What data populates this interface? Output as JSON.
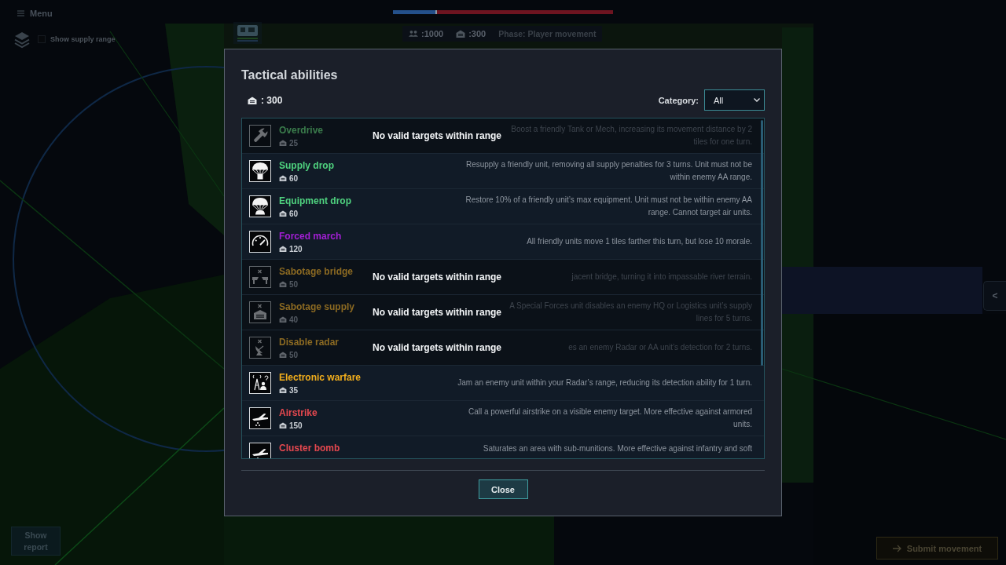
{
  "hud": {
    "menu_button": "Menu",
    "balance_bar": {
      "level": 0.2
    },
    "supply_range_toggle": {
      "label": "Show supply range",
      "checked": false
    },
    "resources": [
      ":1000",
      ":300"
    ],
    "phase": "Phase: Player movement",
    "side_panel_toggle": "<",
    "show_report_button": "Show report",
    "submit_button": "Submit movement"
  },
  "dialog": {
    "title": "Tactical abilities",
    "budget": ": 300",
    "category": {
      "label": "Category:",
      "value": "All"
    },
    "abilities": [
      {
        "name": "Overdrive",
        "color": "#3b7d4c",
        "cost": "25",
        "description": "Boost a friendly Tank or Mech, increasing its movement distance by 2 tiles for one turn.",
        "disabled": true,
        "notice": "No valid targets within range"
      },
      {
        "name": "Supply drop",
        "color": "#4fd27f",
        "cost": "60",
        "description": "Resupply a friendly unit, removing all supply penalties for 3 turns. Unit must not be within enemy AA range.",
        "disabled": false
      },
      {
        "name": "Equipment drop",
        "color": "#4fd27f",
        "cost": "60",
        "description": "Restore 10% of a friendly unit’s max equipment. Unit must not be within enemy AA range. Cannot target air units.",
        "disabled": false
      },
      {
        "name": "Forced march",
        "color": "#a41fd6",
        "cost": "120",
        "description": "All friendly units move 1 tiles farther this turn, but lose 10 morale.",
        "disabled": false
      },
      {
        "name": "Sabotage bridge",
        "color": "#8c6a22",
        "cost": "50",
        "description": "jacent bridge, turning it into impassable river terrain.",
        "disabled": true,
        "notice": "No valid targets within range"
      },
      {
        "name": "Sabotage supply",
        "color": "#8c6a22",
        "cost": "40",
        "description": "A Special Forces unit disables an enemy HQ or Logistics unit’s supply lines for 5 turns.",
        "disabled": true,
        "notice": "No valid targets within range"
      },
      {
        "name": "Disable radar",
        "color": "#8c6a22",
        "cost": "50",
        "description": "es an enemy Radar or AA unit’s detection for 2 turns.",
        "disabled": true,
        "notice": "No valid targets within range"
      },
      {
        "name": "Electronic warfare",
        "color": "#f2ae1c",
        "cost": "35",
        "description": "Jam an enemy unit within your Radar’s range, reducing its detection ability for 1 turn.",
        "disabled": false
      },
      {
        "name": "Airstrike",
        "color": "#e5484f",
        "cost": "150",
        "description": "Call a powerful airstrike on a visible enemy target. More effective against armored units.",
        "disabled": false
      },
      {
        "name": "Cluster bomb",
        "color": "#e5484f",
        "description": "Saturates an area with sub-munitions. More effective against infantry and soft",
        "disabled": false
      }
    ],
    "close_button": "Close"
  }
}
